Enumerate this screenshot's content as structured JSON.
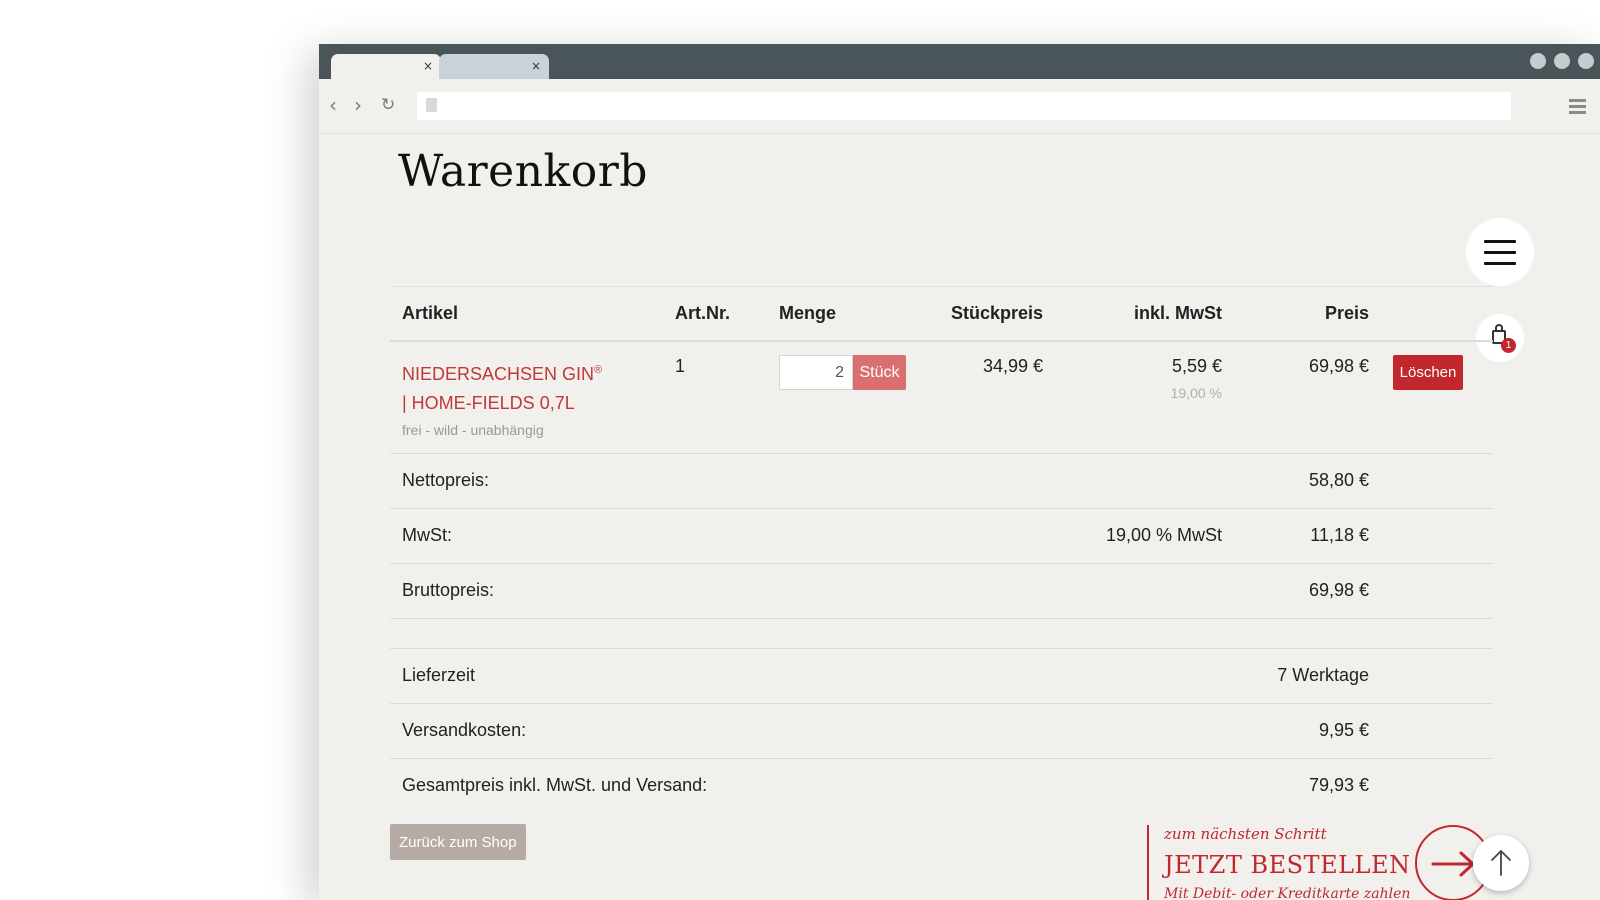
{
  "browser": {
    "tabs": [
      {
        "label": "",
        "close": "×",
        "active": true
      },
      {
        "label": "",
        "close": "×",
        "active": false
      }
    ],
    "nav": {
      "back": "‹",
      "forward": "›",
      "reload": "↻"
    },
    "url": ""
  },
  "page": {
    "title": "Warenkorb",
    "cart_badge": "1"
  },
  "table": {
    "headers": {
      "artikel": "Artikel",
      "artnr": "Art.Nr.",
      "menge": "Menge",
      "stueckpreis": "Stückpreis",
      "mwst": "inkl. MwSt",
      "preis": "Preis"
    },
    "item": {
      "name_line1": "NIEDERSACHSEN GIN",
      "registered": "®",
      "name_line2": "| HOME-FIELDS 0,7l",
      "description": "frei - wild - unabhängig",
      "artnr": "1",
      "quantity": "2",
      "unit": "Stück",
      "unit_price": "34,99 €",
      "tax_amount": "5,59 €",
      "tax_rate": "19,00 %",
      "price": "69,98 €",
      "delete_label": "Löschen"
    },
    "summary": {
      "netto_label": "Nettopreis:",
      "netto_value": "58,80 €",
      "mwst_label": "MwSt:",
      "mwst_rate": "19,00 % MwSt",
      "mwst_value": "11,18 €",
      "brutto_label": "Bruttopreis:",
      "brutto_value": "69,98 €",
      "lieferzeit_label": "Lieferzeit",
      "lieferzeit_value": "7 Werktage",
      "versand_label": "Versandkosten:",
      "versand_value": "9,95 €",
      "gesamt_label": "Gesamtpreis inkl. MwSt. und Versand:",
      "gesamt_value": "79,93 €"
    }
  },
  "actions": {
    "back_label": "Zurück zum Shop",
    "cta_hint": "zum nächsten Schritt",
    "cta_title": "JETZT BESTELLEN",
    "cta_sub": "Mit Debit- oder Kreditkarte zahlen"
  },
  "colors": {
    "accent_red": "#c1272d",
    "qty_unit_bg": "#d9706f",
    "back_btn_bg": "#b5aba4",
    "page_bg": "#f1f0ed",
    "chrome_dark": "#495559"
  },
  "icons": {
    "menu": "hamburger-icon",
    "cart": "shopping-bag-icon",
    "next": "arrow-right-icon",
    "top": "arrow-up-icon"
  }
}
